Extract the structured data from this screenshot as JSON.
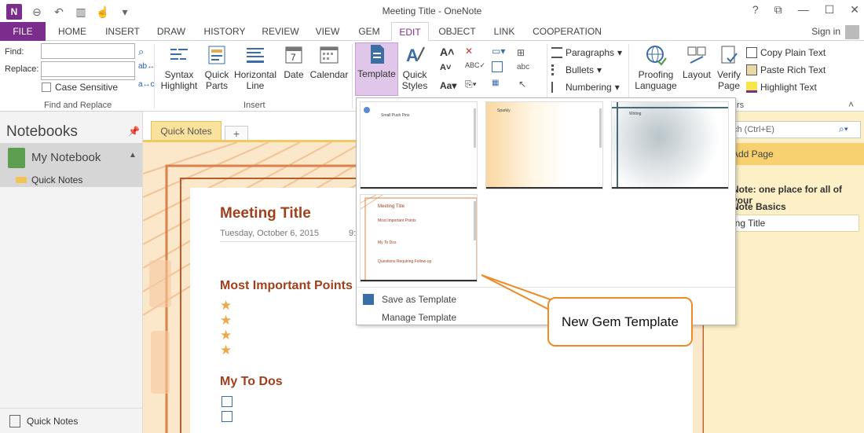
{
  "app": {
    "logo_text": "N",
    "title": "Meeting Title - OneNote",
    "window_controls": [
      "?",
      "⧉",
      "—",
      "☐",
      "✕"
    ]
  },
  "tabs": [
    {
      "label": "FILE",
      "key": "file"
    },
    {
      "label": "HOME",
      "key": "home"
    },
    {
      "label": "INSERT",
      "key": "insert"
    },
    {
      "label": "DRAW",
      "key": "draw"
    },
    {
      "label": "HISTORY",
      "key": "history"
    },
    {
      "label": "REVIEW",
      "key": "review"
    },
    {
      "label": "VIEW",
      "key": "view"
    },
    {
      "label": "GEM",
      "key": "gem"
    },
    {
      "label": "EDIT",
      "key": "edit",
      "active": true
    },
    {
      "label": "OBJECT",
      "key": "object"
    },
    {
      "label": "LINK",
      "key": "link"
    },
    {
      "label": "COOPERATION",
      "key": "cooperation"
    }
  ],
  "signin": "Sign in",
  "ribbon": {
    "find_label": "Find:",
    "replace_label": "Replace:",
    "case_sensitive": "Case Sensitive",
    "find_group": "Find and Replace",
    "insert_group": "Insert",
    "syntax_highlight": "Syntax Highlight",
    "syntax_line1": "Syntax",
    "syntax_line2": "Highlight",
    "quick_parts_line1": "Quick",
    "quick_parts_line2": "Parts",
    "horizontal_line1": "Horizontal",
    "horizontal_line2": "Line",
    "date": "Date",
    "date_icon_num": "7",
    "calendar": "Calendar",
    "template": "Template",
    "quick_styles_line1": "Quick",
    "quick_styles_line2": "Styles",
    "paragraphs": "Paragraphs",
    "bullets": "Bullets",
    "numbering": "Numbering",
    "proofing_line1": "Proofing",
    "proofing_line2": "Language",
    "layout": "Layout",
    "verify_line1": "Verify",
    "verify_line2": "Page",
    "copy_plain": "Copy Plain Text",
    "paste_rich": "Paste Rich Text",
    "highlight_text": "Highlight Text",
    "group_tail": "rs"
  },
  "notebooks": {
    "title": "Notebooks",
    "notebook_name": "My Notebook",
    "section": "Quick Notes",
    "bottom": "Quick Notes"
  },
  "section_tab": "Quick Notes",
  "section_add": "+",
  "page": {
    "title": "Meeting Title",
    "date": "Tuesday, October 6, 2015",
    "time": "9:",
    "heading_important": "Most Important Points",
    "heading_todo": "My To Dos",
    "star_glyph": "★"
  },
  "right_pane": {
    "search": "ch (Ctrl+E)",
    "add_page": "Add Page",
    "page1": "Note: one place for all of your",
    "page2": "Note Basics",
    "page3": "ing Title"
  },
  "gallery": {
    "thumb1_title": "Small Push Pins",
    "thumb2_title": "Sparkly",
    "thumb3_title": "Writing",
    "thumb4_title": "Meeting Title",
    "thumb4_l1": "Most Important Points",
    "thumb4_l2": "My To Dos",
    "thumb4_l3": "Questions Requiring Follow-up",
    "save_template": "Save as Template",
    "manage_template": "Manage Template"
  },
  "callout": "New Gem Template",
  "colors": {
    "accent": "#7b2d8e",
    "callout_border": "#f08a24",
    "heading": "#a0401d",
    "section_tab": "#f9e29c"
  }
}
